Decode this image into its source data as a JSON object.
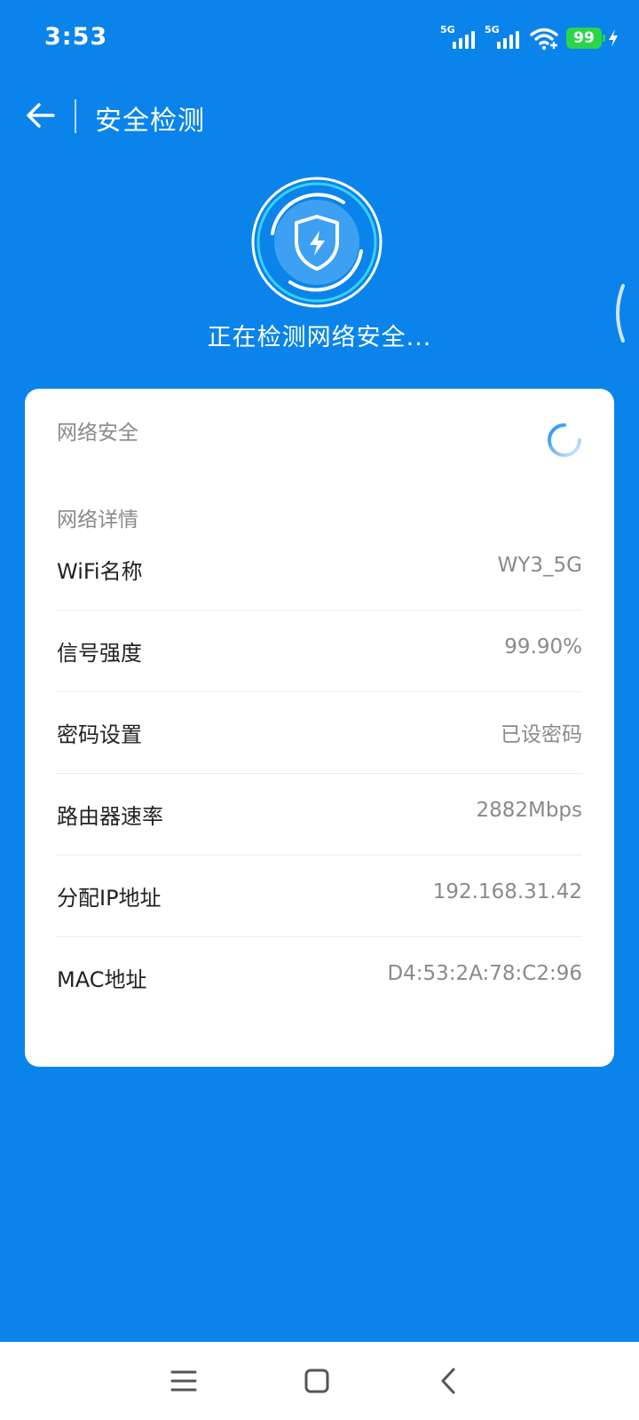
{
  "status_bar": {
    "time": "3:53",
    "network1": "5G",
    "network2": "5G",
    "battery": "99",
    "icons": [
      "signal-icon",
      "signal-icon",
      "wifi-icon",
      "battery-icon",
      "charging-bolt-icon"
    ]
  },
  "header": {
    "title": "安全检测",
    "back_icon": "back-arrow-icon"
  },
  "scan": {
    "icon": "shield-bolt-icon",
    "status_text": "正在检测网络安全..."
  },
  "card": {
    "security_section": "网络安全",
    "loading_icon": "loading-spinner-icon",
    "details_section": "网络详情",
    "rows": [
      {
        "label": "WiFi名称",
        "value": "WY3_5G"
      },
      {
        "label": "信号强度",
        "value": "99.90%"
      },
      {
        "label": "密码设置",
        "value": "已设密码"
      },
      {
        "label": "路由器速率",
        "value": "2882Mbps"
      },
      {
        "label": "分配IP地址",
        "value": "192.168.31.42"
      },
      {
        "label": "MAC地址",
        "value": "D4:53:2A:78:C2:96"
      }
    ]
  },
  "nav_bar": {
    "icons": [
      "menu-icon",
      "home-icon",
      "back-icon"
    ]
  },
  "colors": {
    "primary_blue": "#0a84ea",
    "accent_cyan": "#38d0f5",
    "battery_green": "#2bd44a"
  }
}
